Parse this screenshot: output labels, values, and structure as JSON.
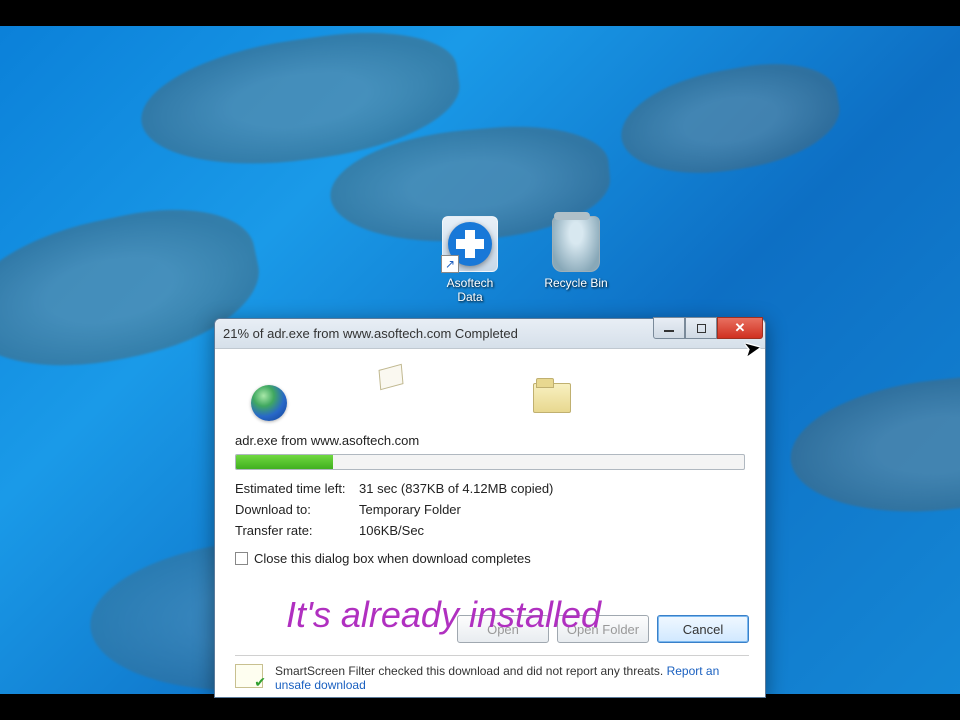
{
  "desktop": {
    "icons": [
      {
        "name": "asoftech",
        "label": "Asoftech\nData"
      },
      {
        "name": "recycle-bin",
        "label": "Recycle Bin"
      }
    ]
  },
  "dialog": {
    "title": "21% of adr.exe from www.asoftech.com Completed",
    "percent": 21,
    "source_line": "adr.exe from www.asoftech.com",
    "progress_pct": 19,
    "stats": {
      "eta_label": "Estimated time left:",
      "eta_value": "31 sec (837KB of 4.12MB copied)",
      "dest_label": "Download to:",
      "dest_value": "Temporary Folder",
      "rate_label": "Transfer rate:",
      "rate_value": "106KB/Sec"
    },
    "close_checkbox": "Close this dialog box when download completes",
    "buttons": {
      "open": "Open",
      "open_folder": "Open Folder",
      "cancel": "Cancel"
    },
    "smartscreen": {
      "text": "SmartScreen Filter checked this download and did not report any threats.",
      "link": "Report an unsafe download"
    }
  },
  "caption": "It's already installed"
}
